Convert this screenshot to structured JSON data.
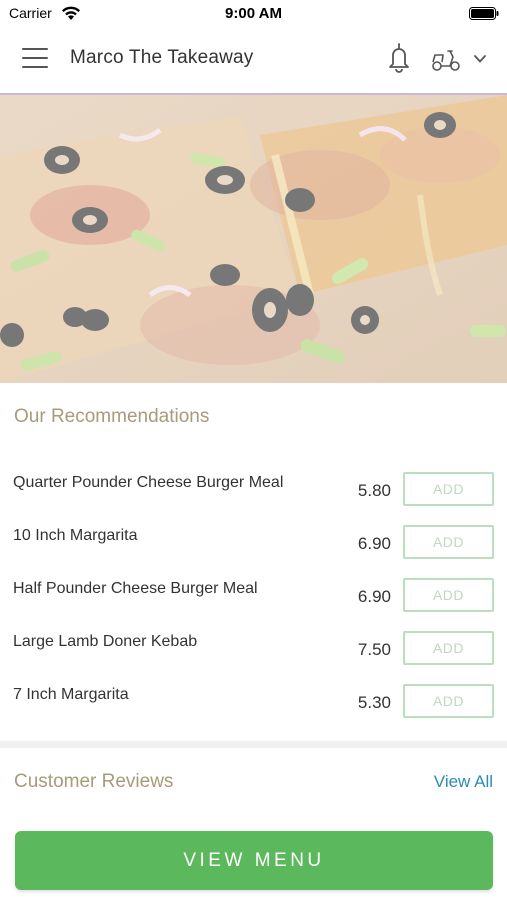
{
  "status_bar": {
    "carrier": "Carrier",
    "time": "9:00 AM"
  },
  "header": {
    "title": "Marco The Takeaway",
    "icons": [
      "menu-icon",
      "bell-icon",
      "scooter-icon",
      "chevron-down-icon"
    ]
  },
  "recommendations": {
    "title": "Our Recommendations",
    "items": [
      {
        "name": "Quarter Pounder Cheese Burger Meal",
        "price": "5.80",
        "button": "ADD"
      },
      {
        "name": "10 Inch Margarita",
        "price": "6.90",
        "button": "ADD"
      },
      {
        "name": "Half Pounder Cheese Burger Meal",
        "price": "6.90",
        "button": "ADD"
      },
      {
        "name": "Large Lamb Doner Kebab",
        "price": "7.50",
        "button": "ADD"
      },
      {
        "name": "7 Inch Margarita",
        "price": "5.30",
        "button": "ADD"
      }
    ]
  },
  "reviews": {
    "title": "Customer Reviews",
    "view_all": "View All"
  },
  "cta": {
    "label": "VIEW MENU"
  },
  "colors": {
    "accent_green": "#5cb85c",
    "section_title": "#a99a78",
    "link_blue": "#2b8bb8"
  }
}
